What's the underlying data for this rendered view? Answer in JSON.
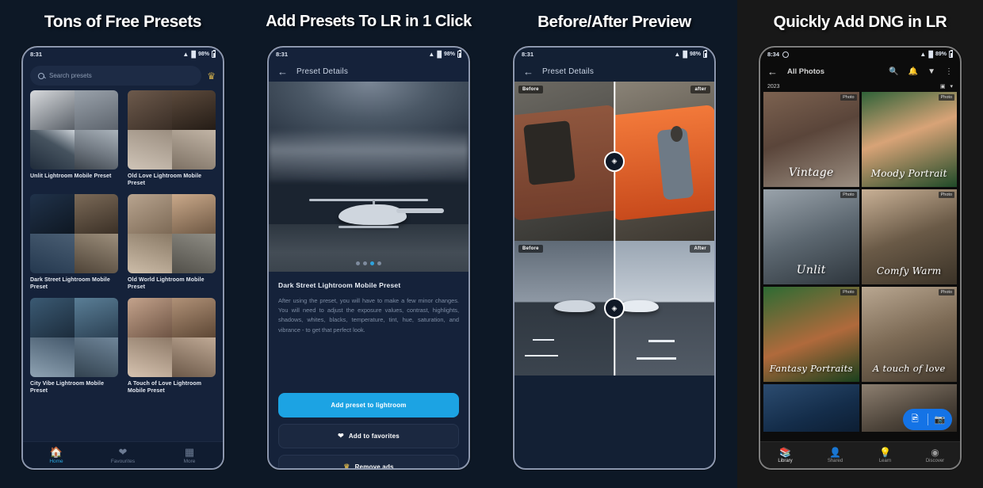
{
  "panels": [
    {
      "title": "Tons of Free Presets",
      "status": {
        "time": "8:31",
        "battery": "98%"
      },
      "search": {
        "placeholder": "Search presets",
        "crown_icon": "crown-icon"
      },
      "presets": [
        {
          "name": "Unlit Lightroom Mobile Preset"
        },
        {
          "name": "Old Love Lightroom Mobile Preset"
        },
        {
          "name": "Dark Street Lightroom Mobile Preset"
        },
        {
          "name": "Old World Lightroom Mobile Preset"
        },
        {
          "name": "City Vibe Lightroom Mobile Preset"
        },
        {
          "name": "A Touch of Love Lightroom Mobile Preset"
        }
      ],
      "tabs": [
        {
          "label": "Home",
          "icon": "home-icon",
          "active": true
        },
        {
          "label": "Favourites",
          "icon": "heart-icon",
          "active": false
        },
        {
          "label": "More",
          "icon": "grid-icon",
          "active": false
        }
      ]
    },
    {
      "title": "Add Presets To LR in 1 Click",
      "status": {
        "time": "8:31",
        "battery": "98%"
      },
      "appbar": {
        "back_icon": "back-arrow-icon",
        "title": "Preset Details"
      },
      "carousel": {
        "dots": 4,
        "active_dot": 3
      },
      "detail": {
        "title": "Dark Street Lightroom Mobile Preset",
        "description": "After using the preset, you will have to make a few minor changes. You will need to adjust the exposure values, contrast, highlights, shadows, whites, blacks, temperature, tint, hue, saturation, and vibrance - to get that perfect look."
      },
      "buttons": [
        {
          "label": "Add preset to lightroom",
          "style": "primary"
        },
        {
          "label": "Add to favorites",
          "style": "secondary",
          "icon": "heart-icon"
        },
        {
          "label": "Remove ads",
          "style": "tertiary",
          "icon": "crown-icon"
        }
      ]
    },
    {
      "title": "Before/After Preview",
      "status": {
        "time": "8:31",
        "battery": "98%"
      },
      "appbar": {
        "back_icon": "back-arrow-icon",
        "title": "Preset Details"
      },
      "previews": [
        {
          "before_label": "Before",
          "after_label": "after",
          "subject": "jeep"
        },
        {
          "before_label": "Before",
          "after_label": "After",
          "subject": "runway"
        }
      ],
      "handle_icon": "compare-handle-icon"
    },
    {
      "title": "Quickly Add DNG in LR",
      "status": {
        "time": "8:34",
        "battery": "89%"
      },
      "appbar": {
        "back_icon": "back-arrow-icon",
        "title": "All Photos",
        "icons": [
          "search-add-icon",
          "bell-icon",
          "filter-icon",
          "overflow-menu-icon"
        ]
      },
      "year_label": "2023",
      "photos": [
        {
          "caption": "Vintage",
          "badge": "Photo"
        },
        {
          "caption": "Moody Portrait",
          "badge": "Photo"
        },
        {
          "caption": "Unlit",
          "badge": "Photo"
        },
        {
          "caption": "Comfy Warm",
          "badge": "Photo"
        },
        {
          "caption": "Fantasy Portraits",
          "badge": "Photo"
        },
        {
          "caption": "A touch of love",
          "badge": "Photo"
        }
      ],
      "fab": {
        "left_icon": "add-photos-icon",
        "right_icon": "camera-icon"
      },
      "tabs": [
        {
          "label": "Library",
          "icon": "library-icon",
          "active": true
        },
        {
          "label": "Shared",
          "icon": "shared-icon",
          "active": false
        },
        {
          "label": "Learn",
          "icon": "learn-icon",
          "active": false
        },
        {
          "label": "Discover",
          "icon": "discover-icon",
          "active": false
        }
      ]
    }
  ],
  "colors": {
    "panel_bg_dark_navy": "#0d1826",
    "panel_bg_black": "#181818",
    "accent_blue": "#1ca3e3",
    "lightroom_blue": "#1473e6",
    "crown_gold": "#c8a84b"
  }
}
